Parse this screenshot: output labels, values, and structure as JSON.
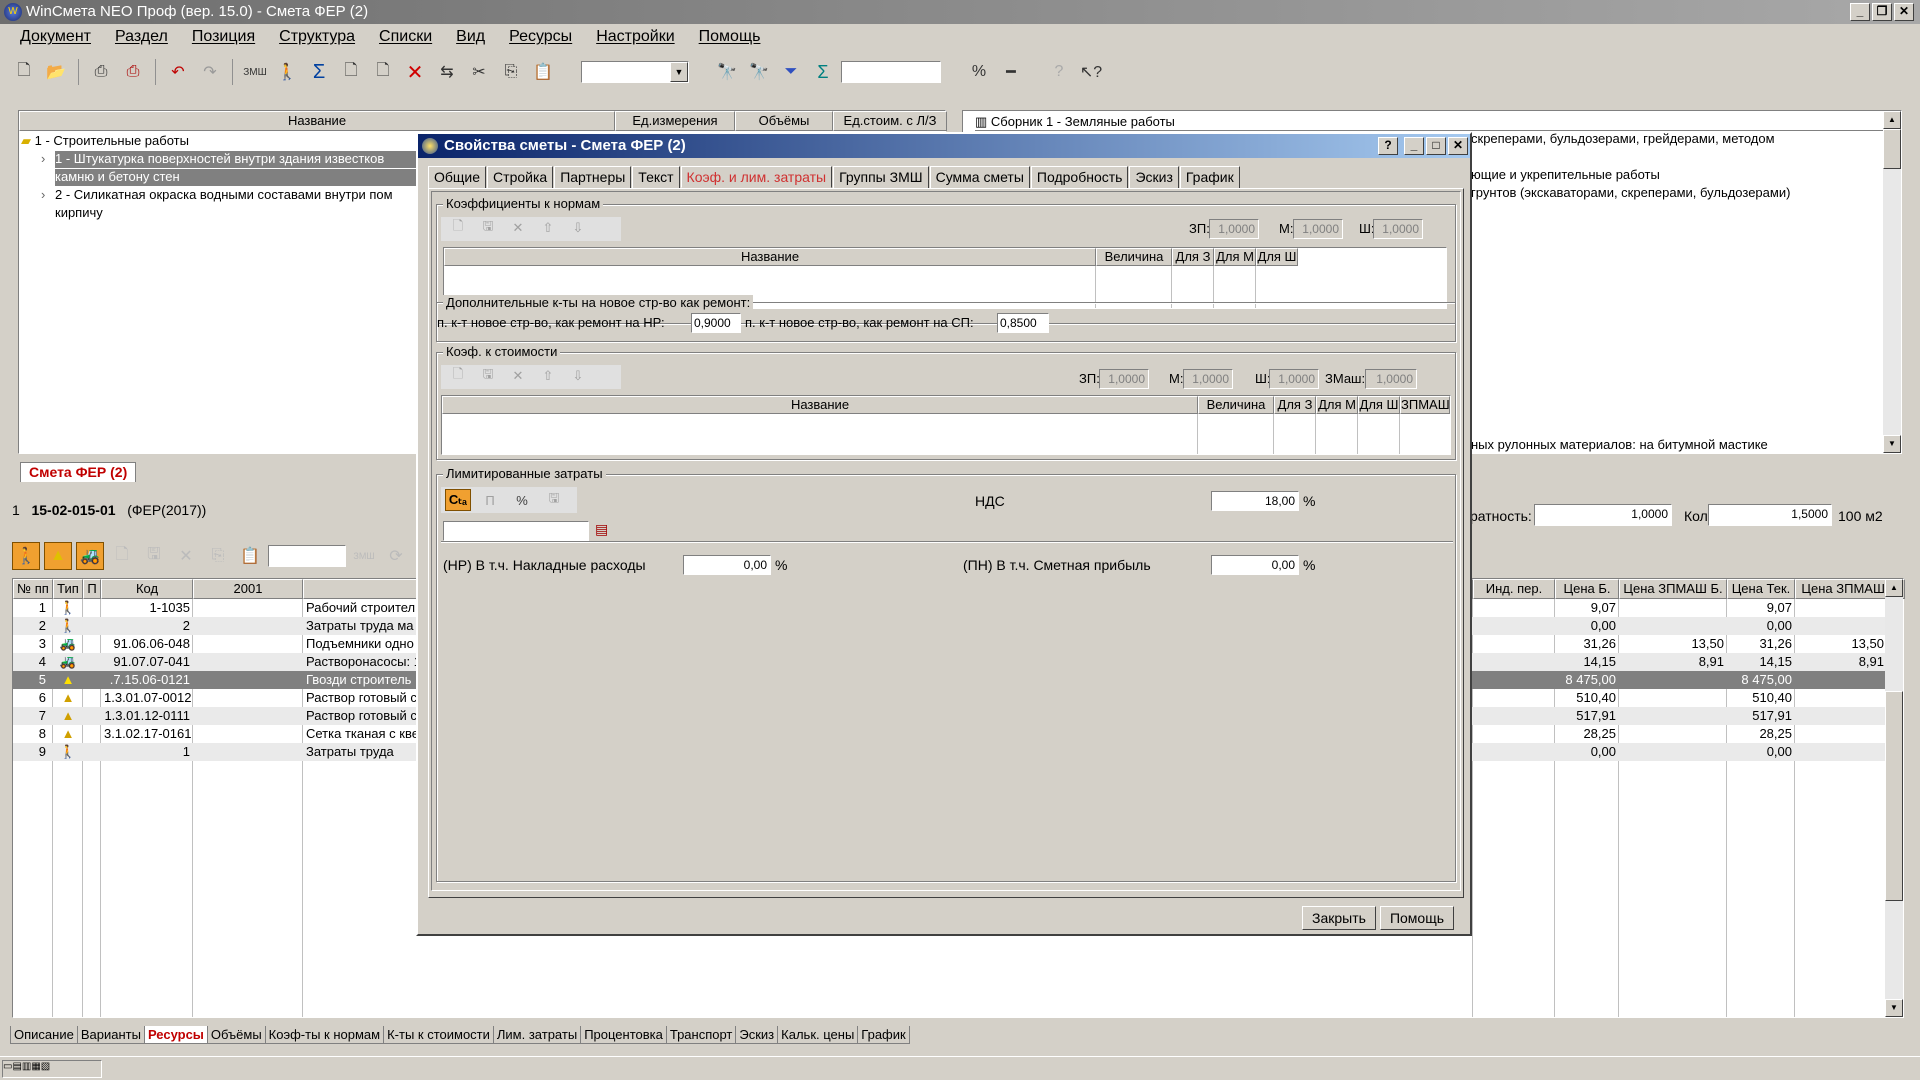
{
  "window": {
    "title": "WinСмета NEO Проф (вер. 15.0) - Смета ФЕР (2)"
  },
  "menu": [
    "Документ",
    "Раздел",
    "Позиция",
    "Структура",
    "Списки",
    "Вид",
    "Ресурсы",
    "Настройки",
    "Помощь"
  ],
  "tree": {
    "headers": [
      "Название",
      "Ед.измерения",
      "Объёмы",
      "Ед.стоим. с Л/З"
    ],
    "items": [
      {
        "label": "1 - Строительные работы"
      },
      {
        "label": "1 - Штукатурка поверхностей внутри здания известков"
      },
      {
        "label": "камню и бетону стен"
      },
      {
        "label": "2 - Силикатная окраска водными составами внутри пом"
      },
      {
        "label": "кирпичу"
      }
    ]
  },
  "right_panel": {
    "header": "Сборник 1 - Земляные работы",
    "lines": [
      "скреперами, бульдозерами, грейдерами, методом",
      "ющие и укрепительные работы",
      "грунтов (экскаваторами, скреперами, бульдозерами)",
      "ных рулонных материалов: на битумной мастике"
    ]
  },
  "doc_tab": "Смета ФЕР (2)",
  "position": {
    "num": "1",
    "code": "15-02-015-01",
    "base": "(ФЕР(2017))",
    "kratnost_label": "ратность:",
    "kratnost": "1,0000",
    "qty_label": "Кол-во:",
    "qty": "1,5000",
    "unit": "100 м2"
  },
  "grid": {
    "headers": [
      "№ пп",
      "Тип",
      "П",
      "Код",
      "2001",
      "",
      "Инд. пер.",
      "Цена Б.",
      "Цена ЗПМАШ Б.",
      "Цена Тек.",
      "Цена ЗПМАШ Т."
    ],
    "rows": [
      {
        "n": "1",
        "code": "1-1035",
        "name": "Рабочий строител",
        "pb": "9,07",
        "zb": "",
        "pt": "9,07",
        "zt": ""
      },
      {
        "n": "2",
        "code": "2",
        "name": "Затраты труда ма",
        "pb": "0,00",
        "zb": "",
        "pt": "0,00",
        "zt": ""
      },
      {
        "n": "3",
        "code": "91.06.06-048",
        "name": "Подъемники одно",
        "pb": "31,26",
        "zb": "13,50",
        "pt": "31,26",
        "zt": "13,50"
      },
      {
        "n": "4",
        "code": "91.07.07-041",
        "name": "Растворонасосы: 1",
        "pb": "14,15",
        "zb": "8,91",
        "pt": "14,15",
        "zt": "8,91"
      },
      {
        "n": "5",
        "code": ".7.15.06-0121",
        "name": "Гвозди строитель",
        "pb": "8 475,00",
        "zb": "",
        "pt": "8 475,00",
        "zt": ""
      },
      {
        "n": "6",
        "code": "1.3.01.07-0012",
        "name": "Раствор готовый с",
        "pb": "510,40",
        "zb": "",
        "pt": "510,40",
        "zt": ""
      },
      {
        "n": "7",
        "code": "1.3.01.12-0111",
        "name": "Раствор готовый с",
        "pb": "517,91",
        "zb": "",
        "pt": "517,91",
        "zt": ""
      },
      {
        "n": "8",
        "code": "3.1.02.17-0161",
        "name": "Сетка тканая с кве",
        "pb": "28,25",
        "zb": "",
        "pt": "28,25",
        "zt": ""
      },
      {
        "n": "9",
        "code": "1",
        "name": "Затраты труда",
        "pb": "0,00",
        "zb": "",
        "pt": "0,00",
        "zt": ""
      }
    ]
  },
  "bottom_tabs": [
    "Описание",
    "Варианты",
    "Ресурсы",
    "Объёмы",
    "Коэф-ты к нормам",
    "К-ты к стоимости",
    "Лим. затраты",
    "Процентовка",
    "Транспорт",
    "Эскиз",
    "Кальк. цены",
    "График"
  ],
  "dialog": {
    "title": "Свойства сметы - Смета ФЕР (2)",
    "tabs": [
      "Общие",
      "Стройка",
      "Партнеры",
      "Текст",
      "Коэф. и лим. затраты",
      "Группы ЗМШ",
      "Сумма сметы",
      "Подробность",
      "Эскиз",
      "График"
    ],
    "norm_group": "Коэффициенты к нормам",
    "norm_zp_label": "ЗП:",
    "norm_zp": "1,0000",
    "norm_m_label": "М:",
    "norm_m": "1,0000",
    "norm_sh_label": "Ш:",
    "norm_sh": "1,0000",
    "norm_headers": [
      "Название",
      "Величина",
      "Для З",
      "Для М",
      "Для Ш"
    ],
    "repair_group": "Дополнительные к-ты на новое стр-во как ремонт:",
    "repair_nr_label": "п. к-т новое стр-во, как ремонт на НР:",
    "repair_nr": "0,9000",
    "repair_sp_label": "п. к-т новое стр-во, как ремонт на СП:",
    "repair_sp": "0,8500",
    "cost_group": "Коэф. к стоимости",
    "cost_zp_label": "ЗП:",
    "cost_zp": "1,0000",
    "cost_m_label": "М:",
    "cost_m": "1,0000",
    "cost_sh_label": "Ш:",
    "cost_sh": "1,0000",
    "cost_zmash_label": "ЗМаш:",
    "cost_zmash": "1,0000",
    "cost_headers": [
      "Название",
      "Величина",
      "Для З",
      "Для М",
      "Для Ш",
      "ЗПМАШ"
    ],
    "lim_group": "Лимитированные затраты",
    "nds_label": "НДС",
    "nds": "18,00",
    "pct": "%",
    "nr_label": "(НР)  В т.ч. Накладные расходы",
    "nr": "0,00",
    "pn_label": "(ПН)  В т.ч. Сметная прибыль",
    "pn": "0,00",
    "close": "Закрыть",
    "help": "Помощь"
  }
}
